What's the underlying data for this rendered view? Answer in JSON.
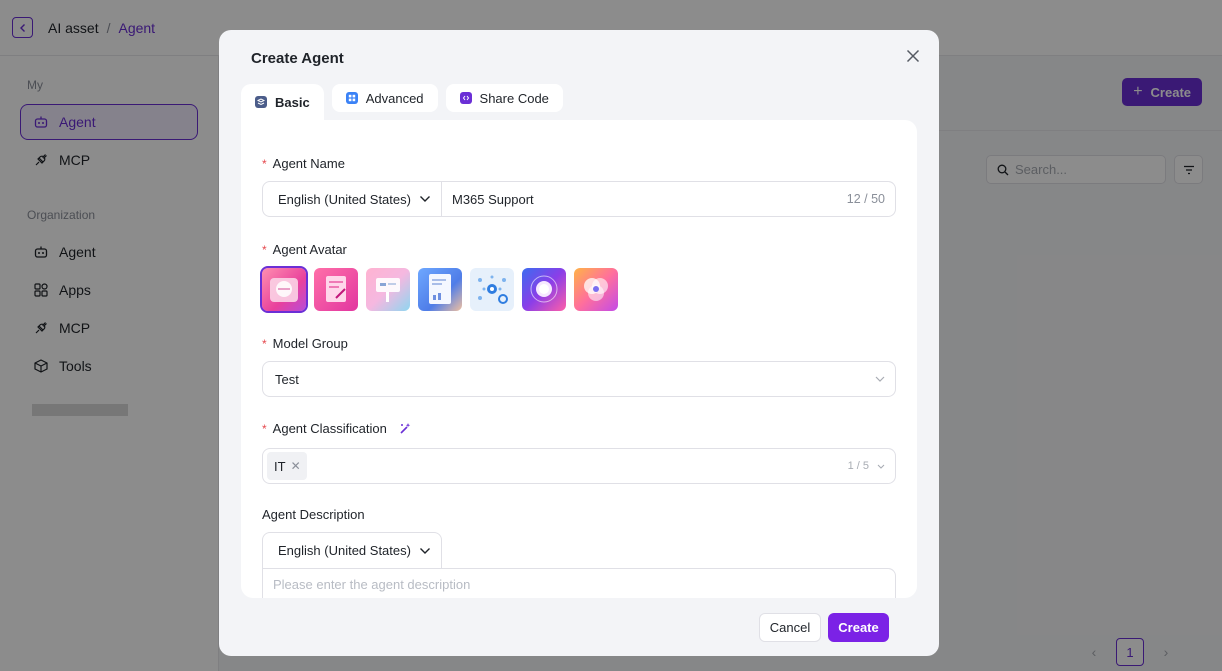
{
  "breadcrumb": {
    "root": "AI asset",
    "separator": "/",
    "current": "Agent"
  },
  "sidebar": {
    "my_section": "My",
    "my_items": [
      {
        "label": "Agent",
        "icon": "robot-icon"
      },
      {
        "label": "MCP",
        "icon": "plug-icon"
      }
    ],
    "org_section": "Organization",
    "org_items": [
      {
        "label": "Agent",
        "icon": "robot-icon"
      },
      {
        "label": "Apps",
        "icon": "apps-icon"
      },
      {
        "label": "MCP",
        "icon": "plug-icon"
      },
      {
        "label": "Tools",
        "icon": "cube-icon"
      }
    ]
  },
  "main": {
    "create_label": "Create",
    "search_placeholder": "Search...",
    "pagination": {
      "current_page": "1"
    }
  },
  "modal": {
    "title": "Create Agent",
    "tabs": [
      {
        "label": "Basic",
        "active": true
      },
      {
        "label": "Advanced"
      },
      {
        "label": "Share Code"
      }
    ],
    "agent_name": {
      "label": "Agent Name",
      "language": "English (United States)",
      "value": "M365 Support",
      "counter": "12 / 50"
    },
    "agent_avatar": {
      "label": "Agent Avatar",
      "selected_index": 0,
      "count": 7
    },
    "model_group": {
      "label": "Model Group",
      "value": "Test"
    },
    "agent_classification": {
      "label": "Agent Classification",
      "tags": [
        "IT"
      ],
      "counter": "1 / 5"
    },
    "agent_description": {
      "label": "Agent Description",
      "language": "English (United States)",
      "placeholder": "Please enter the agent description"
    },
    "footer": {
      "cancel_label": "Cancel",
      "create_label": "Create"
    }
  },
  "colors": {
    "accent": "#6b2fd6",
    "primary_button": "#7b22e6",
    "required": "#e5484d"
  }
}
